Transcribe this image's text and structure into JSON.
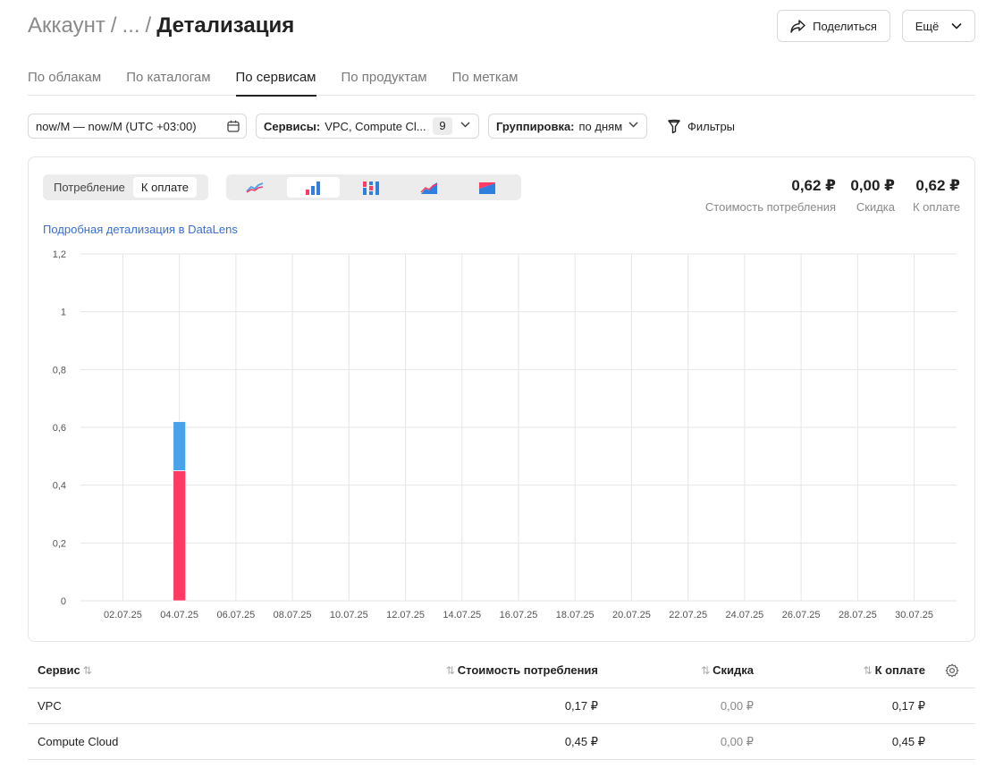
{
  "breadcrumb": {
    "root": "Аккаунт",
    "ellipsis": "...",
    "current": "Детализация"
  },
  "header_actions": {
    "share": "Поделиться",
    "more": "Ещё"
  },
  "tabs": [
    {
      "label": "По облакам"
    },
    {
      "label": "По каталогам"
    },
    {
      "label": "По сервисам",
      "active": true
    },
    {
      "label": "По продуктам"
    },
    {
      "label": "По меткам"
    }
  ],
  "filters": {
    "date_range": "now/M — now/M (UTC +03:00)",
    "services_label": "Сервисы:",
    "services_value": "VPC, Compute Cl...",
    "services_count": "9",
    "grouping_label": "Группировка:",
    "grouping_value": "по дням",
    "filters_button": "Фильтры"
  },
  "mode_switch": {
    "consumption": "Потребление",
    "to_pay": "К оплате",
    "active": "to_pay"
  },
  "chart_types": [
    "line-chart-icon",
    "bar-chart-icon",
    "stacked-bar-icon",
    "area-chart-icon",
    "stacked-area-icon"
  ],
  "totals": [
    {
      "value": "0,62 ₽",
      "label": "Стоимость потребления"
    },
    {
      "value": "0,00 ₽",
      "label": "Скидка"
    },
    {
      "value": "0,62 ₽",
      "label": "К оплате"
    }
  ],
  "datalens_link": "Подробная детализация в DataLens",
  "chart_data": {
    "type": "bar",
    "stacked": true,
    "categories": [
      "01.07",
      "02.07",
      "03.07",
      "04.07",
      "05.07",
      "06.07",
      "07.07",
      "08.07",
      "09.07",
      "10.07",
      "11.07",
      "12.07",
      "13.07",
      "14.07",
      "15.07",
      "16.07",
      "17.07",
      "18.07",
      "19.07",
      "20.07",
      "21.07",
      "22.07",
      "23.07",
      "24.07",
      "25.07",
      "26.07",
      "27.07",
      "28.07",
      "29.07",
      "30.07",
      "31.07"
    ],
    "x_tick_labels": [
      "02.07.25",
      "04.07.25",
      "06.07.25",
      "08.07.25",
      "10.07.25",
      "12.07.25",
      "14.07.25",
      "16.07.25",
      "18.07.25",
      "20.07.25",
      "22.07.25",
      "24.07.25",
      "26.07.25",
      "28.07.25",
      "30.07.25"
    ],
    "y_tick_labels": [
      "0",
      "0,2",
      "0,4",
      "0,6",
      "0,8",
      "1",
      "1,2"
    ],
    "ylim": [
      0,
      1.2
    ],
    "grid": true,
    "series": [
      {
        "name": "Compute Cloud",
        "color": "#ff3b63",
        "values": [
          0,
          0,
          0,
          0.45,
          0,
          0,
          0,
          0,
          0,
          0,
          0,
          0,
          0,
          0,
          0,
          0,
          0,
          0,
          0,
          0,
          0,
          0,
          0,
          0,
          0,
          0,
          0,
          0,
          0,
          0,
          0
        ]
      },
      {
        "name": "VPC",
        "color": "#4aa3ea",
        "values": [
          0,
          0,
          0,
          0.17,
          0,
          0,
          0,
          0,
          0,
          0,
          0,
          0,
          0,
          0,
          0,
          0,
          0,
          0,
          0,
          0,
          0,
          0,
          0,
          0,
          0,
          0,
          0,
          0,
          0,
          0,
          0
        ]
      }
    ]
  },
  "table": {
    "headers": {
      "service": "Сервис",
      "cost": "Стоимость потребления",
      "discount": "Скидка",
      "to_pay": "К оплате"
    },
    "rows": [
      {
        "service": "VPC",
        "cost": "0,17 ₽",
        "discount": "0,00 ₽",
        "to_pay": "0,17 ₽"
      },
      {
        "service": "Compute Cloud",
        "cost": "0,45 ₽",
        "discount": "0,00 ₽",
        "to_pay": "0,45 ₽"
      }
    ]
  }
}
